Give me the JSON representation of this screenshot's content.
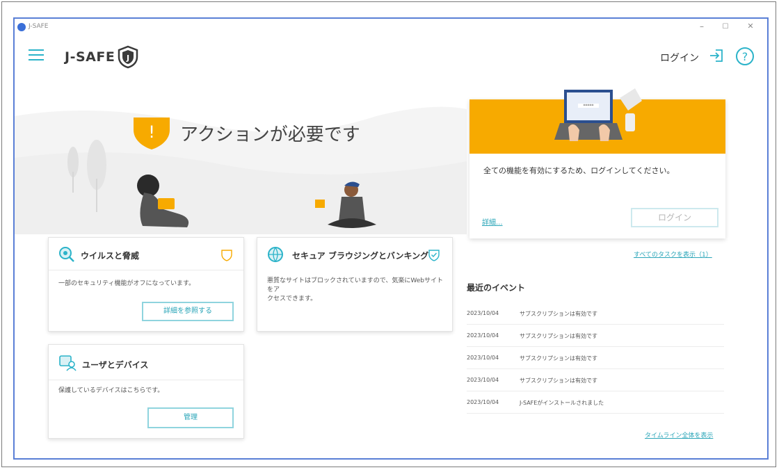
{
  "window": {
    "title": "J-SAFE",
    "controls": {
      "minimize": "–",
      "maximize": "☐",
      "close": "✕"
    }
  },
  "header": {
    "logo_text": "J-SAFE",
    "logo_shield_letter": "J",
    "login_label": "ログイン",
    "help_symbol": "?"
  },
  "action": {
    "title": "アクションが必要です",
    "warning_symbol": "!"
  },
  "cards": {
    "virus": {
      "title": "ウイルスと脅威",
      "text": "一部のセキュリティ機能がオフになっています。",
      "button": "詳細を参照する"
    },
    "browsing": {
      "title": "セキュア ブラウジングとバンキング",
      "text_line1": "悪質なサイトはブロックされていますので、気楽にWebサイトをア",
      "text_line2": "クセスできます。"
    },
    "devices": {
      "title": "ユーザとデバイス",
      "text": "保護しているデバイスはこちらです。",
      "button": "管理"
    }
  },
  "promo": {
    "text": "全ての機能を有効にするため、ログインしてください。",
    "detail_link": "詳細...",
    "login_button": "ログイン",
    "screen_dots": "*****"
  },
  "tasks_link": "すべてのタスクを表示（1）",
  "events": {
    "title": "最近のイベント",
    "rows": [
      {
        "date": "2023/10/04",
        "text": "サブスクリプションは有効です"
      },
      {
        "date": "2023/10/04",
        "text": "サブスクリプションは有効です"
      },
      {
        "date": "2023/10/04",
        "text": "サブスクリプションは有効です"
      },
      {
        "date": "2023/10/04",
        "text": "サブスクリプションは有効です"
      },
      {
        "date": "2023/10/04",
        "text": "J-SAFEがインストールされました"
      }
    ]
  },
  "timeline_link": "タイムライン全体を表示",
  "colors": {
    "accent_teal": "#2bb3c9",
    "warning_orange": "#f7aa00",
    "window_border": "#5a7fd6"
  },
  "icons": {
    "menu": "hamburger-icon",
    "login": "login-arrow-icon",
    "help": "help-circle-icon",
    "virus": "magnifier-shield-icon",
    "browsing": "globe-shield-icon",
    "devices": "user-device-icon",
    "warning": "warning-shield-icon"
  }
}
